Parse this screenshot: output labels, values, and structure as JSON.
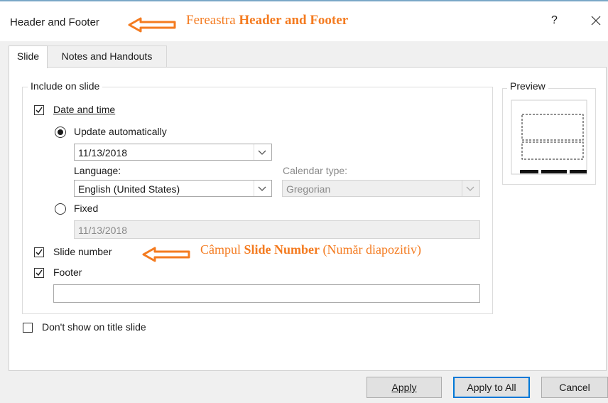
{
  "window": {
    "title": "Header and Footer",
    "help_label": "?",
    "close_label": "✕"
  },
  "annotations": {
    "window_prefix": "Fereastra ",
    "window_bold": "Header and Footer",
    "field_prefix": "Câmpul ",
    "field_bold": "Slide Number",
    "field_suffix": " (Număr diapozitiv)",
    "color": "#f47b20"
  },
  "tabs": [
    {
      "label": "Slide",
      "active": true
    },
    {
      "label": "Notes and Handouts",
      "active": false
    }
  ],
  "include_group": {
    "legend": "Include on slide",
    "date_time": {
      "label": "Date and time",
      "checked": true
    },
    "update_auto": {
      "label": "Update automatically",
      "selected": true
    },
    "date_value": "11/13/2018",
    "language_label": "Language:",
    "language_value": "English (United States)",
    "calendar_label": "Calendar type:",
    "calendar_value": "Gregorian",
    "fixed": {
      "label": "Fixed",
      "selected": false
    },
    "fixed_value": "11/13/2018",
    "slide_number": {
      "label": "Slide number",
      "checked": true
    },
    "footer": {
      "label": "Footer",
      "checked": true
    },
    "footer_value": ""
  },
  "dont_show": {
    "label": "Don't show on title slide",
    "checked": false
  },
  "preview": {
    "legend": "Preview"
  },
  "buttons": {
    "apply": "Apply",
    "apply_all": "Apply to All",
    "cancel": "Cancel"
  },
  "icons": [
    "checkbox-checked-icon",
    "radio-selected-icon",
    "chevron-down-icon",
    "close-icon",
    "arrow-left-icon"
  ]
}
